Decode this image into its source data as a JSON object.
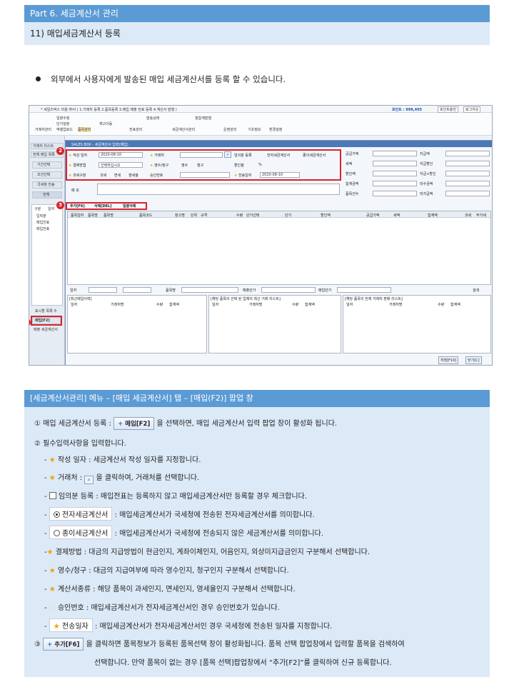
{
  "header": {
    "part_title": "Part 6. 세금계산서 관리",
    "section_title": "11) 매입세금계산서 등록"
  },
  "intro": {
    "bullet_text": "외부에서 사용자에게 발송된 매입 세금계산서를 등록 할 수 있습니다."
  },
  "screenshot": {
    "titlebar": "* 세일즈박스 미용 ㈜서 ( 1.거래처 등록 2.품목등록 3.매입 매출 전표 등록 4.계산서 발행 )",
    "point_label": "포인트 : 998,405",
    "point_charge": "포인트충전",
    "logout": "로그아웃",
    "ribbon": [
      "일괄수정",
      "단가설정",
      "거래처관리",
      "품목관리",
      "재고이동",
      "엑셀업로드",
      "전표관리",
      "발송상태",
      "세금계산서관리",
      "월합계발행",
      "운영관리",
      "기초정보",
      "환경설정"
    ],
    "dialog_title": "SALES BOX - 세금계산서 입력(매입)",
    "left_tabs": [
      "거래처 리스트",
      "전체 매입 목록",
      "기간선택",
      "조건선택",
      "국세청 전송",
      "전체"
    ],
    "left_cols": [
      "구분",
      "일자"
    ],
    "left_rows": [
      "입력분",
      "매입전표",
      "매입전표"
    ],
    "left_bottom": [
      "표시할 목록 수",
      "매입[F2]",
      "매출 세금계산서"
    ],
    "form": {
      "date_label": "작성 일자",
      "date_value": "2020-08-10",
      "client_label": "거래처",
      "partial_reg": "임의분 등록",
      "electronic": "전자세금계산서",
      "paper": "종이세금계산서",
      "pay_label": "결제방법",
      "pay_value": "선택하십시오",
      "receipt_label": "영수/청구",
      "receipt_opts": [
        "영수",
        "청구"
      ],
      "discount_label": "할인율",
      "discount_unit": "%",
      "tax_label": "과세구분",
      "tax_opts": [
        "과세",
        "면세",
        "영세율"
      ],
      "approval_label": "승인번호",
      "send_date_label": "전송일자",
      "send_date_value": "2020-08-10",
      "memo_label": "메 모"
    },
    "totals": [
      "공급가액",
      "지급액",
      "세액",
      "지급할인",
      "할인액",
      "지급+할인",
      "합계금액",
      "미수금액",
      "품목건수",
      "미지급액"
    ],
    "item_buttons": [
      "추가[F6]",
      "삭제[DEL]",
      "일괄삭제"
    ],
    "grid_cols": [
      "품목일자",
      "품목명",
      "품목명",
      "품목코드",
      "창고명",
      "단위",
      "규격",
      "수량",
      "단가선택",
      "단가",
      "할인액",
      "공급가액",
      "세액",
      "합계액",
      "과세",
      "부가세"
    ],
    "filter": [
      "일자",
      "품목명",
      "매출단가",
      "매입단가",
      "검색"
    ],
    "panels": [
      {
        "title": "[최근매입이력]",
        "cols": [
          "일자",
          "거래처명",
          "수량",
          "합계액"
        ]
      },
      {
        "title": "[해당 품목의 선택 된 업체의 최근 거래 리스트]",
        "cols": [
          "일자",
          "거래처명",
          "수량",
          "합계액"
        ]
      },
      {
        "title": "[해당 품목의 전체 거래처 판매 리스트]",
        "cols": [
          "일자",
          "거래처명",
          "수량",
          "합계액"
        ]
      }
    ],
    "save_btn": "저장[F10]",
    "close_btn": "닫기[C]",
    "badges": [
      "1",
      "2",
      "3"
    ]
  },
  "section": {
    "title": "[세금계산서관리] 메뉴 – [매입 세금계산서] 탭 – [매입(F2)] 팝업 창",
    "l1_num": "①",
    "l1_pre": "매입 세금계산서 등록 :",
    "l1_btn": "매입[F2]",
    "l1_post": "을 선택하면, 매입 세금계산서 입력 팝업 창이 활성화 됩니다.",
    "l2_num": "②",
    "l2_text": "필수입력사항을 입력합니다.",
    "items": [
      {
        "pre": "-",
        "text": "작성 일자 : 세금계산서 작성 일자를 지정합니다."
      },
      {
        "pre": "-",
        "text_a": "거래처 :",
        "text_b": "을 클릭하여, 거래처를 선택합니다."
      },
      {
        "pre": "-",
        "text": "임의분 등록 : 매입전표는 등록하지 않고 매입세금계산서만 등록할 경우 체크합니다."
      },
      {
        "pre": "-",
        "chip": "전자세금계산서",
        "text": ": 매입세금계산서가 국세청에 전송된 전자세금계산서를 의미합니다."
      },
      {
        "pre": "-",
        "chip": "종이세금계산서",
        "text": ": 매입세금계산서가 국세청에 전송되지 않은 세금계산서를 의미합니다."
      },
      {
        "pre": "-",
        "text": "결제방법 : 대금의 지급방법이 현금인지, 계좌이체인지, 어음인지, 외상미지급금인지 구분해서 선택합니다."
      },
      {
        "pre": "-",
        "text": "영수/청구 : 대금의 지급여부에 따라 영수인지, 청구인지 구분해서 선택합니다."
      },
      {
        "pre": "-",
        "text": "계산서종류 : 해당 품목이 과세인지, 면세인지, 영세율인지 구분해서 선택합니다."
      },
      {
        "pre": "-",
        "text": "승인번호 : 매입세금계산서가 전자세금계산서인 경우 승인번호가 있습니다."
      },
      {
        "pre": "-",
        "chip": "전송일자",
        "text": ": 매입세금계산서가 전자세금계산서인 경우 국세청에 전송된 일자를 지정합니다."
      }
    ],
    "l3_num": "③",
    "l3_btn": "추가[F6]",
    "l3_text": "을 클릭하면 품목정보가 등록된 품목선택 창이 활성화됩니다. 품목 선택 팝업창에서 입력할 품목을 검색하여",
    "l3_text2": "선택합니다. 만약 품목이 없는 경우 [품목 선택]팝업창에서 “추가[F2]”를 클릭하여 신규 등록합니다."
  },
  "colors": {
    "header_blue": "#5b9bd5",
    "light_blue": "#dce9f7",
    "highlight_red": "#d9232e",
    "star": "#e8a400"
  }
}
